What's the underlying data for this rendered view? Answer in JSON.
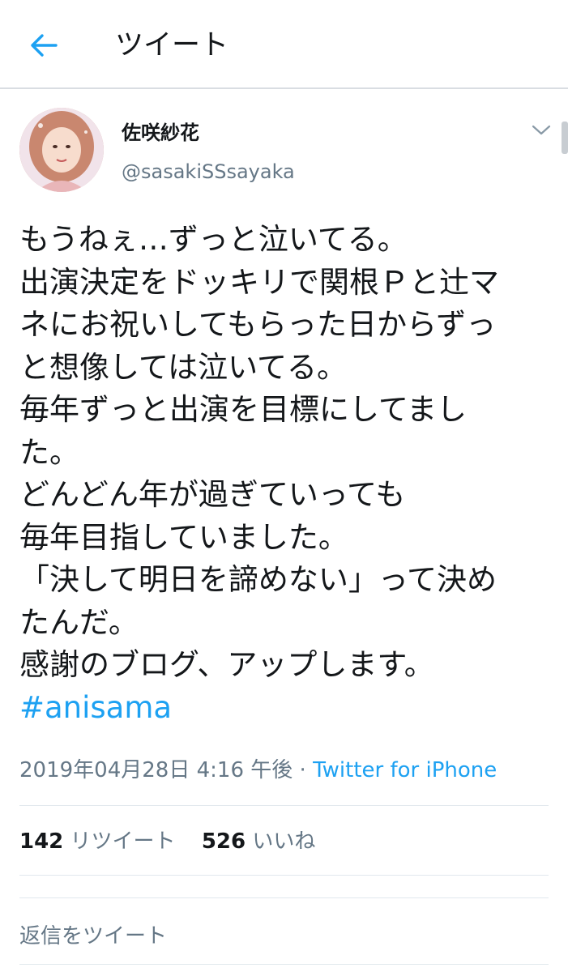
{
  "header": {
    "back_icon": "arrow-left-icon",
    "title": "ツイート"
  },
  "accent_color": "#1da1f2",
  "user": {
    "display_name": "佐咲紗花",
    "handle": "@sasakiSSsayaka"
  },
  "tweet": {
    "lines": [
      "もうねぇ…ずっと泣いてる。",
      "出演決定をドッキリで関根Ｐと辻マ",
      "ネにお祝いしてもらった日からずっ",
      "と想像しては泣いてる。",
      "毎年ずっと出演を目標にしてまし",
      "た。",
      "どんどん年が過ぎていっても",
      "毎年目指していました。",
      "「決して明日を諦めない」って決め",
      "たんだ。",
      "感謝のブログ、アップします。"
    ],
    "hashtag": "#anisama",
    "timestamp": "2019年04月28日 4:16 午後",
    "separator": "·",
    "source": "Twitter for iPhone"
  },
  "stats": {
    "retweets_count": "142",
    "retweets_label": "リツイート",
    "likes_count": "526",
    "likes_label": "いいね"
  },
  "reply": {
    "placeholder": "返信をツイート"
  }
}
